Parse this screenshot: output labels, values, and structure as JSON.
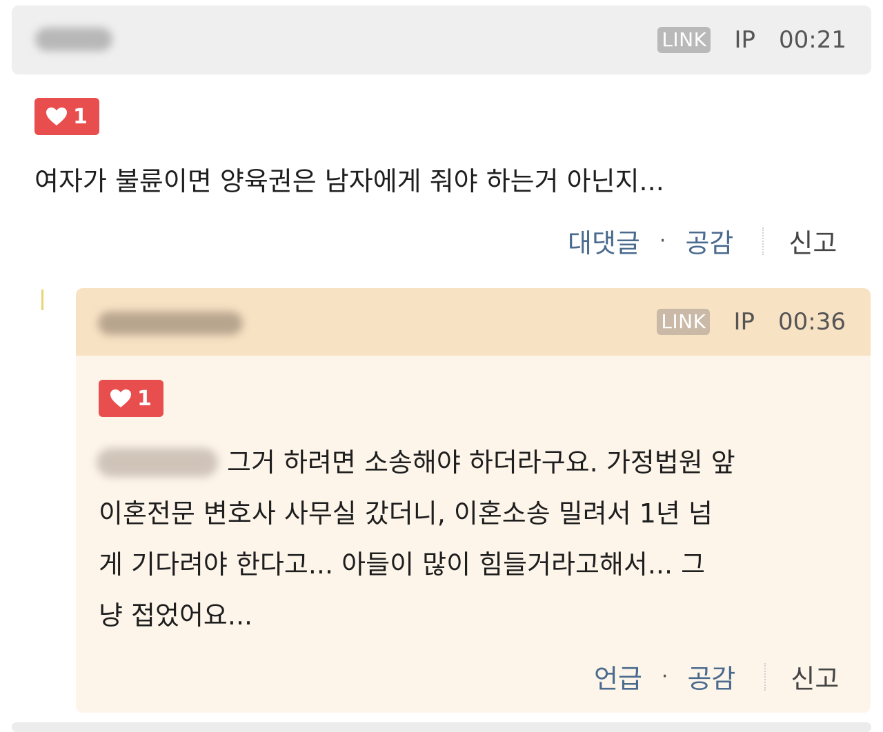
{
  "comment": {
    "link_badge": "LINK",
    "ip_label": "IP",
    "time": "00:21",
    "likes": "1",
    "text": "여자가 불륜이면 양육권은 남자에게 줘야 하는거 아닌지...",
    "actions": {
      "reply": "대댓글",
      "dot": "·",
      "empathy": "공감",
      "report": "신고"
    }
  },
  "reply": {
    "link_badge": "LINK",
    "ip_label": "IP",
    "time": "00:36",
    "likes": "1",
    "lines": [
      "그거 하려면 소송해야 하더라구요. 가정법원 앞",
      "이혼전문 변호사 사무실 갔더니, 이혼소송 밀려서 1년 넘",
      "게 기다려야 한다고... 아들이 많이 힘들거라고해서... 그",
      "냥 접었어요..."
    ],
    "actions": {
      "mention": "언급",
      "dot": "·",
      "empathy": "공감",
      "report": "신고"
    }
  },
  "icons": {
    "heart": "heart-icon"
  },
  "colors": {
    "like_red": "#e94e4e",
    "action_blue": "#4a6a8e",
    "reply_head": "#f8e2c4",
    "reply_body": "#fdf5ea"
  }
}
